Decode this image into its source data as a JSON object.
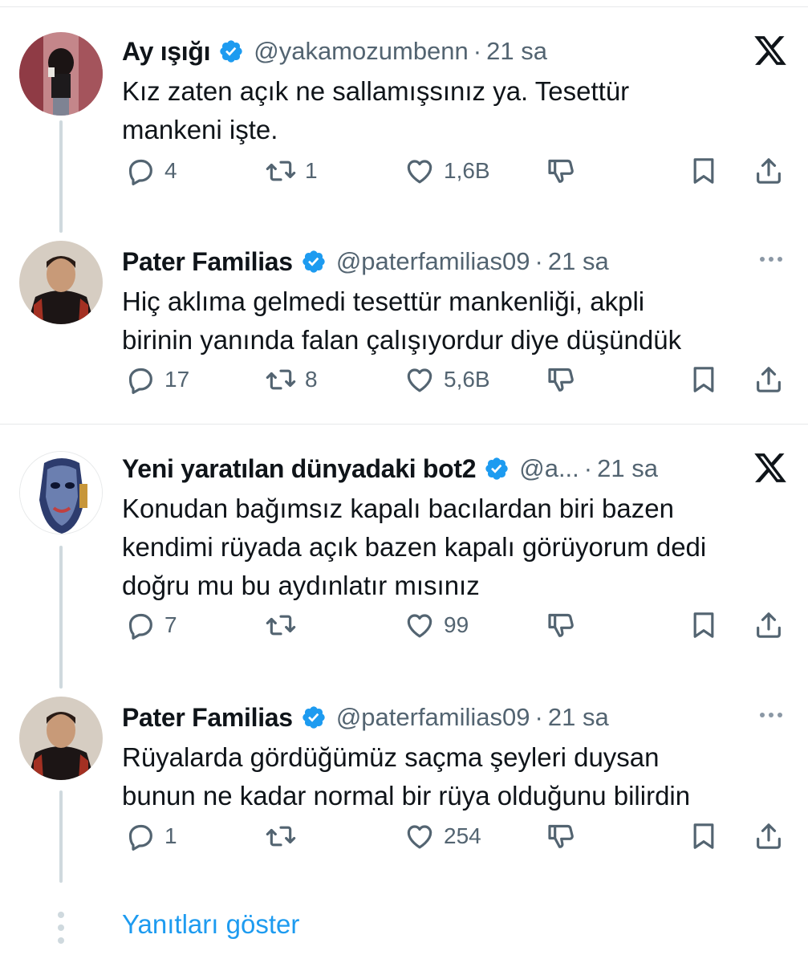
{
  "tweets": [
    {
      "name": "Ay ışığı",
      "handle": "@yakamozumbenn",
      "dot": "·",
      "time": "21 sa",
      "corner": "x-logo",
      "text_lines": [
        "Kız zaten açık ne sallamışsınız ya. Tesettür",
        "mankeni işte."
      ],
      "replies": "4",
      "retweets": "1",
      "likes": "1,6B"
    },
    {
      "name": "Pater Familias",
      "handle": "@paterfamilias09",
      "dot": "·",
      "time": "21 sa",
      "corner": "more",
      "text_lines": [
        "Hiç aklıma gelmedi tesettür mankenliği, akpli",
        "birinin yanında falan çalışıyordur diye düşündük"
      ],
      "replies": "17",
      "retweets": "8",
      "likes": "5,6B"
    },
    {
      "name": "Yeni yaratılan dünyadaki bot2",
      "handle": "@a...",
      "dot": "·",
      "time": "21 sa",
      "corner": "x-logo",
      "text_lines": [
        "Konudan bağımsız kapalı bacılardan biri bazen",
        "kendimi rüyada açık bazen kapalı görüyorum dedi",
        "doğru mu bu aydınlatır mısınız"
      ],
      "replies": "7",
      "retweets": "",
      "likes": "99"
    },
    {
      "name": "Pater Familias",
      "handle": "@paterfamilias09",
      "dot": "·",
      "time": "21 sa",
      "corner": "more",
      "text_lines": [
        "Rüyalarda gördüğümüz saçma şeyleri duysan",
        "bunun ne kadar normal bir rüya olduğunu bilirdin"
      ],
      "replies": "1",
      "retweets": "",
      "likes": "254"
    }
  ],
  "show_replies": "Yanıtları göster",
  "colors": {
    "accent": "#1d9bf0",
    "muted": "#536471",
    "line": "#cfd9de"
  }
}
